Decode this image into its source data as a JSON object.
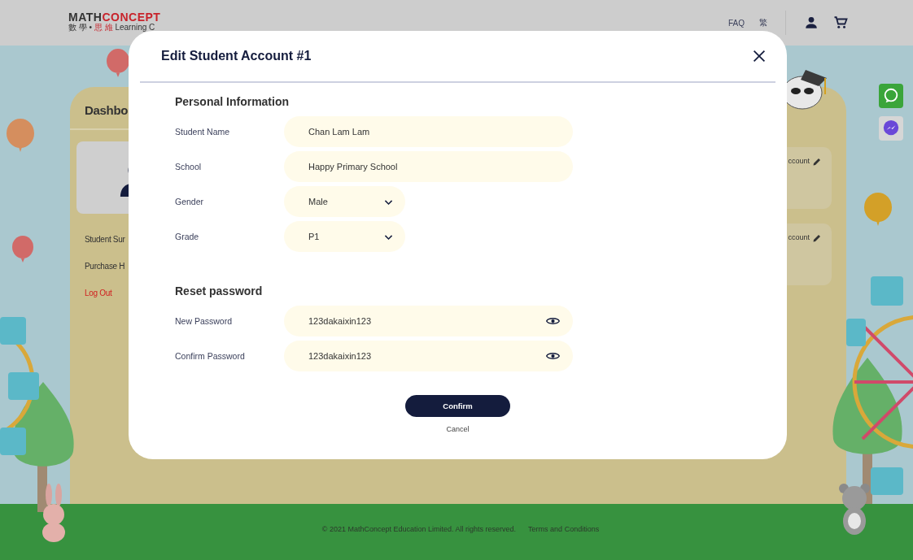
{
  "header": {
    "logo": {
      "word_1": "MATH",
      "word_2": "CONCEPT",
      "tagline_1": "數 學 •",
      "tagline_2": "思 維",
      "tagline_3": "Learning C"
    },
    "links": [
      "FAQ",
      "繁"
    ]
  },
  "dashboard": {
    "title": "Dashbo",
    "menu": [
      {
        "label": "Student Sur",
        "kind": "link"
      },
      {
        "label": "Purchase H",
        "kind": "link"
      },
      {
        "label": "Log Out",
        "kind": "logout"
      }
    ],
    "cards": [
      {
        "label": "ccount"
      },
      {
        "label": "ccount"
      }
    ]
  },
  "modal": {
    "title": "Edit Student Account #1",
    "sections": [
      {
        "heading": "Personal Information",
        "fields": [
          {
            "label": "Student Name",
            "kind": "text",
            "value": "Chan Lam Lam"
          },
          {
            "label": "School",
            "kind": "text",
            "value": "Happy Primary School"
          },
          {
            "label": "Gender",
            "kind": "select",
            "value": "Male"
          },
          {
            "label": "Grade",
            "kind": "select",
            "value": "P1"
          }
        ]
      },
      {
        "heading": "Reset password",
        "fields": [
          {
            "label": "New Password",
            "kind": "password",
            "value": "123dakaixin123"
          },
          {
            "label": "Confirm Password",
            "kind": "password",
            "value": "123dakaixin123"
          }
        ]
      }
    ],
    "confirm": "Confirm",
    "cancel": "Cancel"
  },
  "footer": {
    "copyright": "© 2021 MathConcept Education Limited. All rights reserved.",
    "terms": "Terms and Conditions"
  }
}
